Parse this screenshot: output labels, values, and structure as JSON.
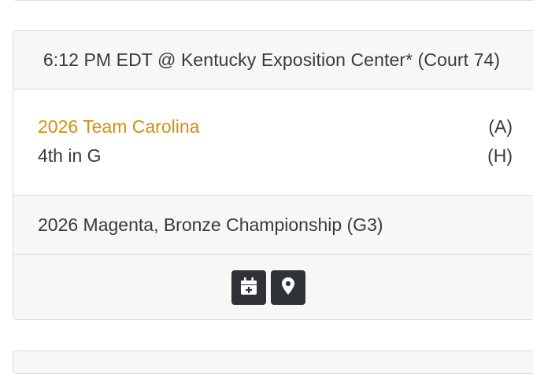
{
  "game": {
    "header": "6:12 PM EDT @ Kentucky Exposition Center* (Court 74)",
    "team_a": {
      "name": "2026 Team Carolina",
      "side": "(A)"
    },
    "team_h": {
      "name": "4th in G",
      "side": "(H)"
    },
    "event": "2026 Magenta, Bronze Championship (G3)",
    "actions": [
      {
        "icon": "calendar-plus-icon"
      },
      {
        "icon": "map-marker-icon"
      }
    ]
  },
  "colors": {
    "accent_link": "#d4900c",
    "button_bg": "#2f3236",
    "header_bg": "#f7f7f7",
    "border": "#dcdcdc"
  }
}
